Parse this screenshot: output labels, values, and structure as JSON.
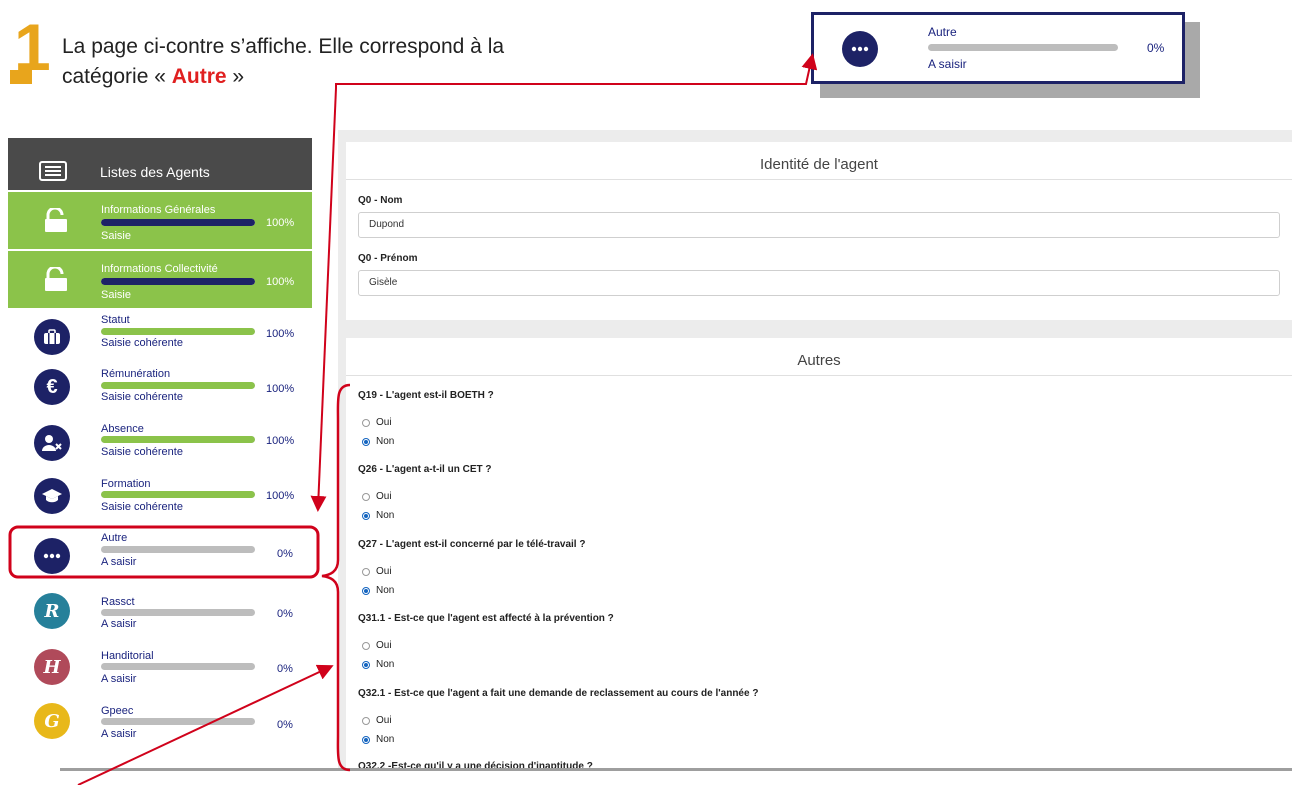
{
  "step": {
    "number": "1",
    "line1": "La page ci-contre s’affiche. Elle correspond à la",
    "line2_prefix": "catégorie « ",
    "line2_highlight": "Autre",
    "line2_suffix": " »"
  },
  "callout": {
    "title": "Autre",
    "status": "A saisir",
    "percent": "0%",
    "progress": 0,
    "icon": "ellipsis-icon"
  },
  "sidebar": {
    "header_label": "Listes des Agents",
    "items": [
      {
        "title": "Informations Générales",
        "status": "Saisie",
        "percent": "100%",
        "progress": 1,
        "icon": "unlock-icon"
      },
      {
        "title": "Informations Collectivité",
        "status": "Saisie",
        "percent": "100%",
        "progress": 1,
        "icon": "unlock-icon"
      },
      {
        "title": "Statut",
        "status": "Saisie cohérente",
        "percent": "100%",
        "progress": 1,
        "icon": "briefcase-icon"
      },
      {
        "title": "Rémunération",
        "status": "Saisie cohérente",
        "percent": "100%",
        "progress": 1,
        "icon": "euro-icon"
      },
      {
        "title": "Absence",
        "status": "Saisie cohérente",
        "percent": "100%",
        "progress": 1,
        "icon": "user-x-icon"
      },
      {
        "title": "Formation",
        "status": "Saisie cohérente",
        "percent": "100%",
        "progress": 1,
        "icon": "graduation-cap-icon"
      },
      {
        "title": "Autre",
        "status": "A saisir",
        "percent": "0%",
        "progress": 0,
        "icon": "ellipsis-icon"
      },
      {
        "title": "Rassct",
        "status": "A saisir",
        "percent": "0%",
        "progress": 0,
        "icon": "r-icon",
        "glyph": "R"
      },
      {
        "title": "Handitorial",
        "status": "A saisir",
        "percent": "0%",
        "progress": 0,
        "icon": "h-icon",
        "glyph": "H"
      },
      {
        "title": "Gpeec",
        "status": "A saisir",
        "percent": "0%",
        "progress": 0,
        "icon": "g-icon",
        "glyph": "G"
      }
    ]
  },
  "identity": {
    "title": "Identité de l'agent",
    "nom_label": "Q0 - Nom",
    "nom_value": "Dupond",
    "prenom_label": "Q0 - Prénom",
    "prenom_value": "Gisèle"
  },
  "autres": {
    "title": "Autres",
    "options": {
      "oui": "Oui",
      "non": "Non"
    },
    "questions": [
      {
        "label": "Q19 - L'agent est-il BOETH ?",
        "selected": "non"
      },
      {
        "label": "Q26 - L'agent a-t-il un CET ?",
        "selected": "non"
      },
      {
        "label": "Q27 - L'agent est-il concerné par le télé-travail ?",
        "selected": "non"
      },
      {
        "label": "Q31.1 - Est-ce que l'agent est affecté à la prévention ?",
        "selected": "non"
      },
      {
        "label": "Q32.1 - Est-ce que l'agent a fait une demande de reclassement au cours de l'année ?",
        "selected": "non"
      },
      {
        "label": "Q32.2 -Est-ce qu'il y a une décision d'inaptitude ?"
      }
    ]
  },
  "colors": {
    "navy": "#1d2266",
    "green": "#8bc34a",
    "accent_red": "#d0021b",
    "step_orange": "#e8a51c",
    "rassct": "#26809a",
    "handitorial": "#b04a5a",
    "gpeec": "#e8b81a"
  }
}
